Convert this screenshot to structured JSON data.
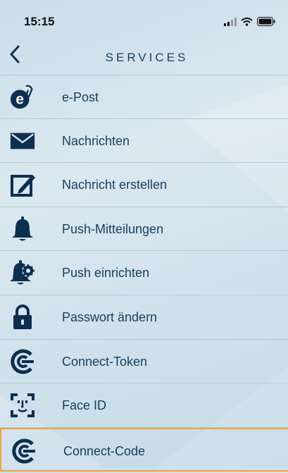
{
  "status": {
    "time": "15:15"
  },
  "nav": {
    "title": "SERVICES"
  },
  "items": [
    {
      "label": "e-Post",
      "icon": "epost-icon"
    },
    {
      "label": "Nachrichten",
      "icon": "envelope-icon"
    },
    {
      "label": "Nachricht erstellen",
      "icon": "compose-icon"
    },
    {
      "label": "Push-Mitteilungen",
      "icon": "bell-icon"
    },
    {
      "label": "Push einrichten",
      "icon": "bell-gear-icon"
    },
    {
      "label": "Passwort ändern",
      "icon": "lock-icon"
    },
    {
      "label": "Connect-Token",
      "icon": "connect-icon"
    },
    {
      "label": "Face ID",
      "icon": "face-id-icon"
    },
    {
      "label": "Connect-Code",
      "icon": "connect-icon"
    }
  ],
  "colors": {
    "icon": "#0d2f4f",
    "text": "#163f5c",
    "highlight": "#f1a23a"
  }
}
